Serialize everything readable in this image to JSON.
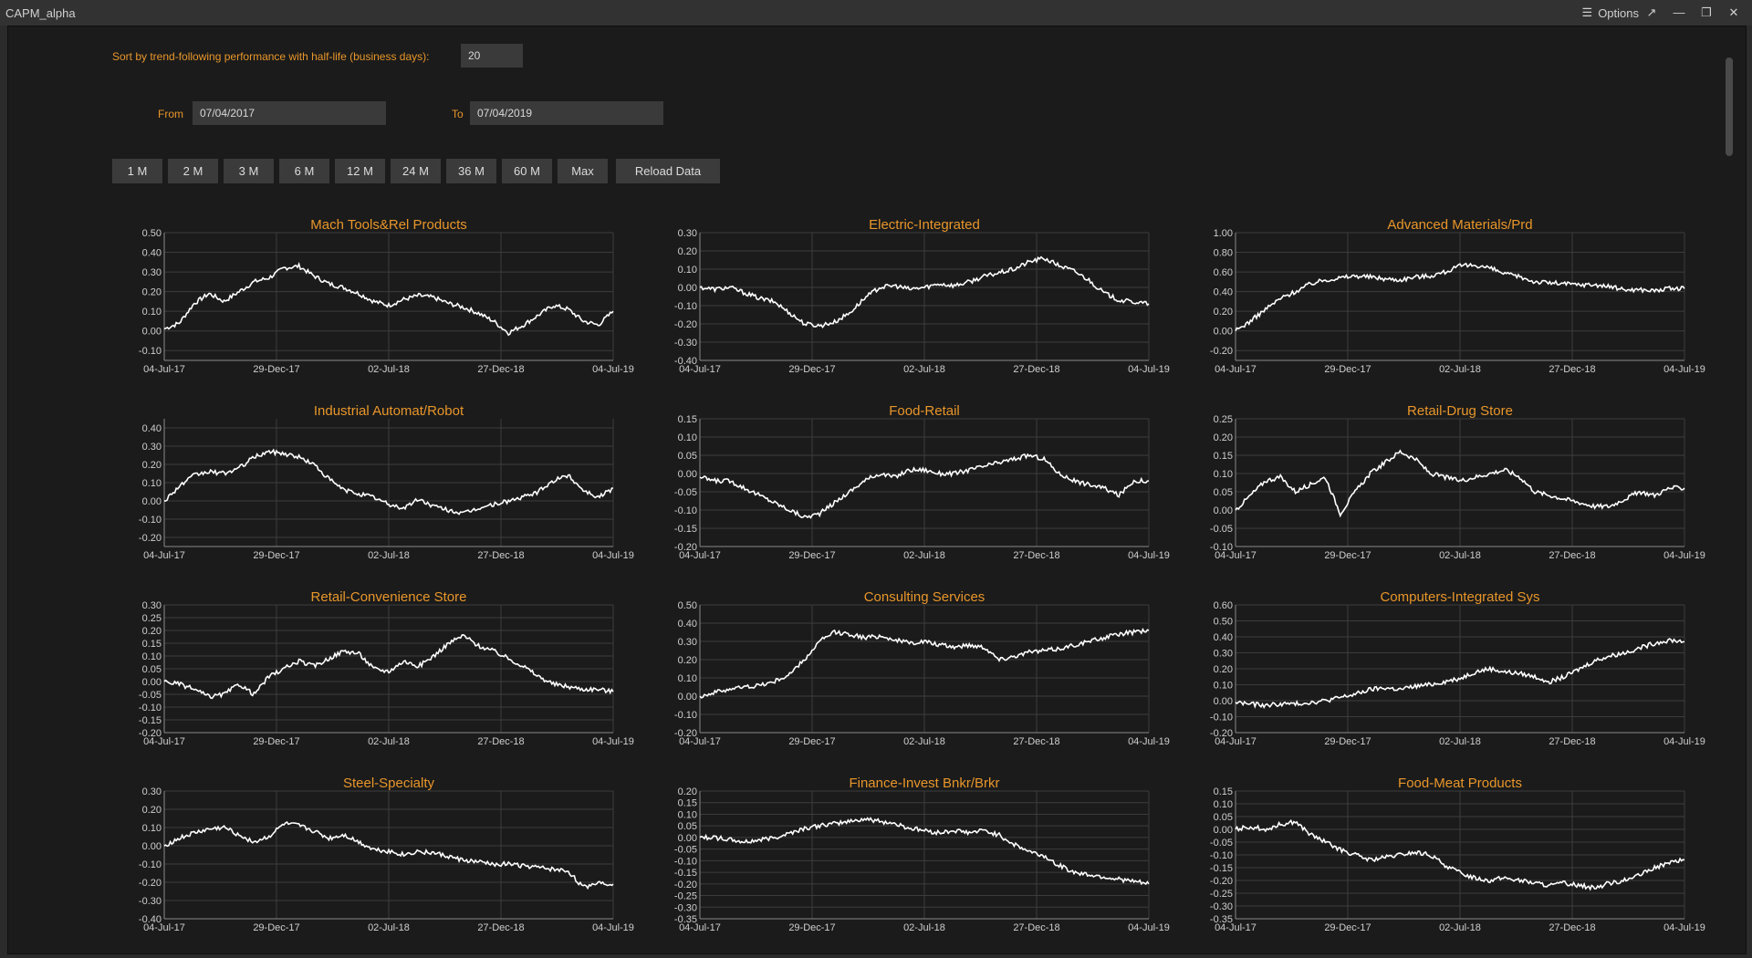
{
  "window": {
    "title": "CAPM_alpha",
    "options_label": "Options",
    "popout_icon": "popout-icon",
    "minimize_icon": "minimize-icon",
    "restore_icon": "restore-icon",
    "close_icon": "close-icon"
  },
  "controls": {
    "sort_label": "Sort by trend-following performance with half-life (business days):",
    "half_life": "20",
    "from_label": "From",
    "from_date": "07/04/2017",
    "to_label": "To",
    "to_date": "07/04/2019",
    "periods": [
      "1 M",
      "2 M",
      "3 M",
      "6 M",
      "12 M",
      "24 M",
      "36 M",
      "60 M",
      "Max"
    ],
    "reload_label": "Reload Data"
  },
  "colors": {
    "accent": "#e8962a",
    "line": "#ffffff",
    "grid": "#3c3c3c",
    "background": "#1b1b1b"
  },
  "chart_data": [
    {
      "type": "line",
      "title": "Mach Tools&Rel Products",
      "x_ticks": [
        "04-Jul-17",
        "29-Dec-17",
        "02-Jul-18",
        "27-Dec-18",
        "04-Jul-19"
      ],
      "ylim": [
        -0.15,
        0.5
      ],
      "y_ticks": [
        "0.50",
        "0.40",
        "0.30",
        "0.20",
        "0.10",
        "0.00",
        "-0.10"
      ],
      "y": [
        0.01,
        0.04,
        0.14,
        0.19,
        0.15,
        0.2,
        0.25,
        0.27,
        0.32,
        0.33,
        0.28,
        0.24,
        0.22,
        0.19,
        0.15,
        0.13,
        0.16,
        0.18,
        0.17,
        0.14,
        0.12,
        0.09,
        0.05,
        -0.01,
        0.03,
        0.08,
        0.13,
        0.11,
        0.05,
        0.03,
        0.1
      ]
    },
    {
      "type": "line",
      "title": "Electric-Integrated",
      "x_ticks": [
        "04-Jul-17",
        "29-Dec-17",
        "02-Jul-18",
        "27-Dec-18",
        "04-Jul-19"
      ],
      "ylim": [
        -0.4,
        0.3
      ],
      "y_ticks": [
        "0.30",
        "0.20",
        "0.10",
        "0.00",
        "-0.10",
        "-0.20",
        "-0.30",
        "-0.40"
      ],
      "y": [
        0.0,
        -0.01,
        0.0,
        -0.03,
        -0.06,
        -0.08,
        -0.14,
        -0.2,
        -0.21,
        -0.19,
        -0.14,
        -0.06,
        0.0,
        0.01,
        -0.01,
        0.0,
        0.02,
        0.01,
        0.03,
        0.06,
        0.08,
        0.1,
        0.14,
        0.16,
        0.12,
        0.09,
        0.04,
        -0.03,
        -0.07,
        -0.08,
        -0.09
      ]
    },
    {
      "type": "line",
      "title": "Advanced Materials/Prd",
      "x_ticks": [
        "04-Jul-17",
        "29-Dec-17",
        "02-Jul-18",
        "27-Dec-18",
        "04-Jul-19"
      ],
      "ylim": [
        -0.3,
        1.0
      ],
      "y_ticks": [
        "1.00",
        "0.80",
        "0.60",
        "0.40",
        "0.20",
        "0.00",
        "-0.20"
      ],
      "y": [
        0.0,
        0.1,
        0.22,
        0.33,
        0.4,
        0.48,
        0.52,
        0.54,
        0.56,
        0.55,
        0.53,
        0.52,
        0.55,
        0.56,
        0.6,
        0.66,
        0.67,
        0.64,
        0.58,
        0.55,
        0.5,
        0.49,
        0.48,
        0.47,
        0.47,
        0.45,
        0.42,
        0.42,
        0.41,
        0.43,
        0.43
      ]
    },
    {
      "type": "line",
      "title": "Industrial Automat/Robot",
      "x_ticks": [
        "04-Jul-17",
        "29-Dec-17",
        "02-Jul-18",
        "27-Dec-18",
        "04-Jul-19"
      ],
      "ylim": [
        -0.25,
        0.45
      ],
      "y_ticks": [
        "0.40",
        "0.30",
        "0.20",
        "0.10",
        "0.00",
        "-0.10",
        "-0.20"
      ],
      "y": [
        0.0,
        0.08,
        0.14,
        0.16,
        0.15,
        0.18,
        0.24,
        0.27,
        0.26,
        0.24,
        0.2,
        0.12,
        0.06,
        0.04,
        0.02,
        -0.02,
        -0.04,
        0.01,
        -0.03,
        -0.05,
        -0.07,
        -0.04,
        -0.02,
        0.0,
        0.02,
        0.05,
        0.11,
        0.14,
        0.06,
        0.02,
        0.07
      ]
    },
    {
      "type": "line",
      "title": "Food-Retail",
      "x_ticks": [
        "04-Jul-17",
        "29-Dec-17",
        "02-Jul-18",
        "27-Dec-18",
        "04-Jul-19"
      ],
      "ylim": [
        -0.2,
        0.15
      ],
      "y_ticks": [
        "0.15",
        "0.10",
        "0.05",
        "0.00",
        "-0.05",
        "-0.10",
        "-0.15",
        "-0.20"
      ],
      "y": [
        -0.01,
        -0.02,
        -0.02,
        -0.04,
        -0.06,
        -0.08,
        -0.1,
        -0.12,
        -0.11,
        -0.08,
        -0.05,
        -0.02,
        0.0,
        -0.01,
        0.01,
        0.01,
        0.0,
        0.0,
        0.01,
        0.02,
        0.03,
        0.04,
        0.05,
        0.04,
        0.0,
        -0.02,
        -0.03,
        -0.04,
        -0.06,
        -0.02,
        -0.02
      ]
    },
    {
      "type": "line",
      "title": "Retail-Drug Store",
      "x_ticks": [
        "04-Jul-17",
        "29-Dec-17",
        "02-Jul-18",
        "27-Dec-18",
        "04-Jul-19"
      ],
      "ylim": [
        -0.1,
        0.25
      ],
      "y_ticks": [
        "0.25",
        "0.20",
        "0.15",
        "0.10",
        "0.05",
        "0.00",
        "-0.05",
        "-0.10"
      ],
      "y": [
        0.0,
        0.04,
        0.08,
        0.09,
        0.05,
        0.07,
        0.09,
        -0.01,
        0.05,
        0.1,
        0.13,
        0.16,
        0.14,
        0.1,
        0.09,
        0.08,
        0.09,
        0.1,
        0.11,
        0.09,
        0.05,
        0.04,
        0.03,
        0.02,
        0.01,
        0.01,
        0.03,
        0.05,
        0.04,
        0.06,
        0.06
      ]
    },
    {
      "type": "line",
      "title": "Retail-Convenience Store",
      "x_ticks": [
        "04-Jul-17",
        "29-Dec-17",
        "02-Jul-18",
        "27-Dec-18",
        "04-Jul-19"
      ],
      "ylim": [
        -0.2,
        0.3
      ],
      "y_ticks": [
        "0.30",
        "0.25",
        "0.20",
        "0.15",
        "0.10",
        "0.05",
        "0.00",
        "-0.05",
        "-0.10",
        "-0.15",
        "-0.20"
      ],
      "y": [
        0.0,
        -0.01,
        -0.03,
        -0.06,
        -0.05,
        -0.01,
        -0.05,
        0.02,
        0.05,
        0.08,
        0.06,
        0.09,
        0.12,
        0.11,
        0.05,
        0.04,
        0.08,
        0.06,
        0.1,
        0.15,
        0.18,
        0.14,
        0.12,
        0.09,
        0.06,
        0.02,
        -0.01,
        -0.02,
        -0.03,
        -0.03,
        -0.04
      ]
    },
    {
      "type": "line",
      "title": "Consulting Services",
      "x_ticks": [
        "04-Jul-17",
        "29-Dec-17",
        "02-Jul-18",
        "27-Dec-18",
        "04-Jul-19"
      ],
      "ylim": [
        -0.2,
        0.5
      ],
      "y_ticks": [
        "0.50",
        "0.40",
        "0.30",
        "0.20",
        "0.10",
        "0.00",
        "-0.10",
        "-0.20"
      ],
      "y": [
        0.0,
        0.02,
        0.04,
        0.05,
        0.06,
        0.08,
        0.12,
        0.2,
        0.3,
        0.35,
        0.34,
        0.32,
        0.33,
        0.31,
        0.29,
        0.3,
        0.28,
        0.27,
        0.28,
        0.27,
        0.2,
        0.22,
        0.24,
        0.25,
        0.26,
        0.28,
        0.3,
        0.32,
        0.34,
        0.35,
        0.36
      ]
    },
    {
      "type": "line",
      "title": "Computers-Integrated Sys",
      "x_ticks": [
        "04-Jul-17",
        "29-Dec-17",
        "02-Jul-18",
        "27-Dec-18",
        "04-Jul-19"
      ],
      "ylim": [
        -0.2,
        0.6
      ],
      "y_ticks": [
        "0.60",
        "0.50",
        "0.40",
        "0.30",
        "0.20",
        "0.10",
        "0.00",
        "-0.10",
        "-0.20"
      ],
      "y": [
        -0.01,
        -0.02,
        -0.03,
        -0.02,
        -0.02,
        -0.01,
        0.0,
        0.02,
        0.04,
        0.07,
        0.08,
        0.07,
        0.09,
        0.1,
        0.12,
        0.14,
        0.18,
        0.2,
        0.18,
        0.17,
        0.15,
        0.12,
        0.15,
        0.2,
        0.25,
        0.28,
        0.3,
        0.33,
        0.36,
        0.38,
        0.37
      ]
    },
    {
      "type": "line",
      "title": "Steel-Specialty",
      "x_ticks": [
        "04-Jul-17",
        "29-Dec-17",
        "02-Jul-18",
        "27-Dec-18",
        "04-Jul-19"
      ],
      "ylim": [
        -0.4,
        0.3
      ],
      "y_ticks": [
        "0.30",
        "0.20",
        "0.10",
        "0.00",
        "-0.10",
        "-0.20",
        "-0.30",
        "-0.40"
      ],
      "y": [
        0.0,
        0.04,
        0.07,
        0.09,
        0.1,
        0.06,
        0.02,
        0.05,
        0.12,
        0.11,
        0.08,
        0.04,
        0.06,
        0.02,
        -0.02,
        -0.03,
        -0.05,
        -0.03,
        -0.04,
        -0.06,
        -0.08,
        -0.09,
        -0.1,
        -0.1,
        -0.11,
        -0.12,
        -0.13,
        -0.14,
        -0.23,
        -0.2,
        -0.21
      ]
    },
    {
      "type": "line",
      "title": "Finance-Invest Bnkr/Brkr",
      "x_ticks": [
        "04-Jul-17",
        "29-Dec-17",
        "02-Jul-18",
        "27-Dec-18",
        "04-Jul-19"
      ],
      "ylim": [
        -0.35,
        0.2
      ],
      "y_ticks": [
        "0.20",
        "0.15",
        "0.10",
        "0.05",
        "0.00",
        "-0.05",
        "-0.10",
        "-0.15",
        "-0.20",
        "-0.25",
        "-0.30",
        "-0.35"
      ],
      "y": [
        0.0,
        0.0,
        -0.01,
        -0.02,
        -0.01,
        0.0,
        0.02,
        0.04,
        0.05,
        0.06,
        0.07,
        0.08,
        0.07,
        0.06,
        0.04,
        0.03,
        0.02,
        0.03,
        0.02,
        0.03,
        0.01,
        -0.03,
        -0.06,
        -0.08,
        -0.12,
        -0.15,
        -0.16,
        -0.17,
        -0.18,
        -0.19,
        -0.2
      ]
    },
    {
      "type": "line",
      "title": "Food-Meat Products",
      "x_ticks": [
        "04-Jul-17",
        "29-Dec-17",
        "02-Jul-18",
        "27-Dec-18",
        "04-Jul-19"
      ],
      "ylim": [
        -0.35,
        0.15
      ],
      "y_ticks": [
        "0.15",
        "0.10",
        "0.05",
        "0.00",
        "-0.05",
        "-0.10",
        "-0.15",
        "-0.20",
        "-0.25",
        "-0.30",
        "-0.35"
      ],
      "y": [
        0.0,
        0.01,
        0.0,
        0.02,
        0.03,
        -0.02,
        -0.05,
        -0.08,
        -0.1,
        -0.12,
        -0.11,
        -0.1,
        -0.09,
        -0.1,
        -0.14,
        -0.17,
        -0.19,
        -0.2,
        -0.19,
        -0.2,
        -0.21,
        -0.22,
        -0.21,
        -0.22,
        -0.23,
        -0.21,
        -0.2,
        -0.18,
        -0.15,
        -0.13,
        -0.12
      ]
    }
  ]
}
